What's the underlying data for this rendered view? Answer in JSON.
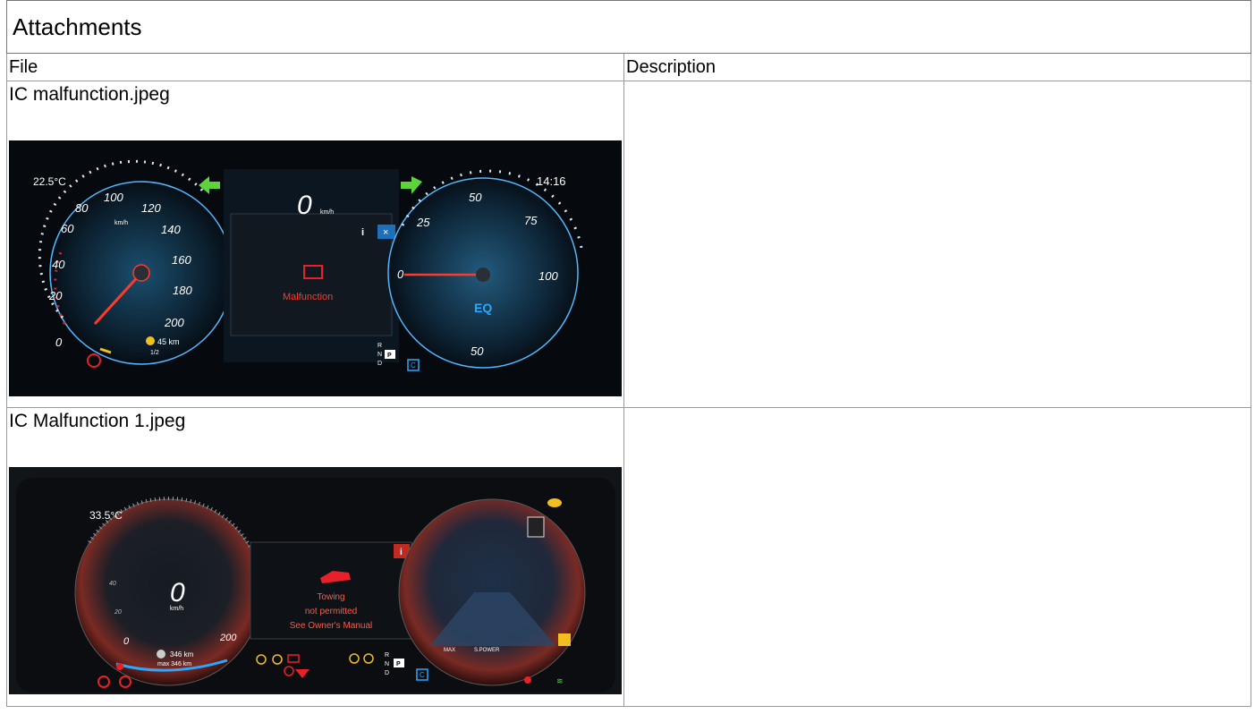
{
  "attachments": {
    "title": "Attachments",
    "columns": {
      "file": "File",
      "description": "Description"
    },
    "items": [
      {
        "file_name": "IC malfunction.jpeg",
        "description": "",
        "image": {
          "temperature": "22.5°C",
          "clock": "14:16",
          "speed_value": "0",
          "speed_unit": "km/h",
          "gauge_unit": "km/h",
          "left_ticks": [
            "0",
            "20",
            "40",
            "60",
            "80",
            "100",
            "120",
            "140",
            "160",
            "180",
            "200"
          ],
          "right_ticks": [
            "0",
            "25",
            "50",
            "75",
            "100",
            "50"
          ],
          "message": "Malfunction",
          "range": "45 km",
          "fuel_fraction": "1/2",
          "gear_letters": [
            "R",
            "N",
            "P",
            "D"
          ],
          "mode": "C",
          "eq_badge": "EQ",
          "colors": {
            "accent": "#2aa8ff",
            "warning": "#e8202a",
            "arrow": "#5cd43a"
          }
        }
      },
      {
        "file_name": "IC Malfunction 1.jpeg",
        "description": "",
        "image": {
          "temperature": "33.5°C",
          "speed_value": "0",
          "speed_unit": "km/h",
          "left_ticks": [
            "0",
            "20",
            "40",
            "200"
          ],
          "message_lines": [
            "Towing",
            "not permitted",
            "See Owner's Manual"
          ],
          "range_1": "346 km",
          "range_2": "max 346 km",
          "power_labels": [
            "MAX",
            "S.POWER"
          ],
          "gear_letters": [
            "R",
            "N",
            "P",
            "D"
          ],
          "mode": "C",
          "colors": {
            "glow": "#ff3a2a",
            "warning": "#e8202a",
            "amber": "#f0c020"
          }
        }
      }
    ]
  }
}
